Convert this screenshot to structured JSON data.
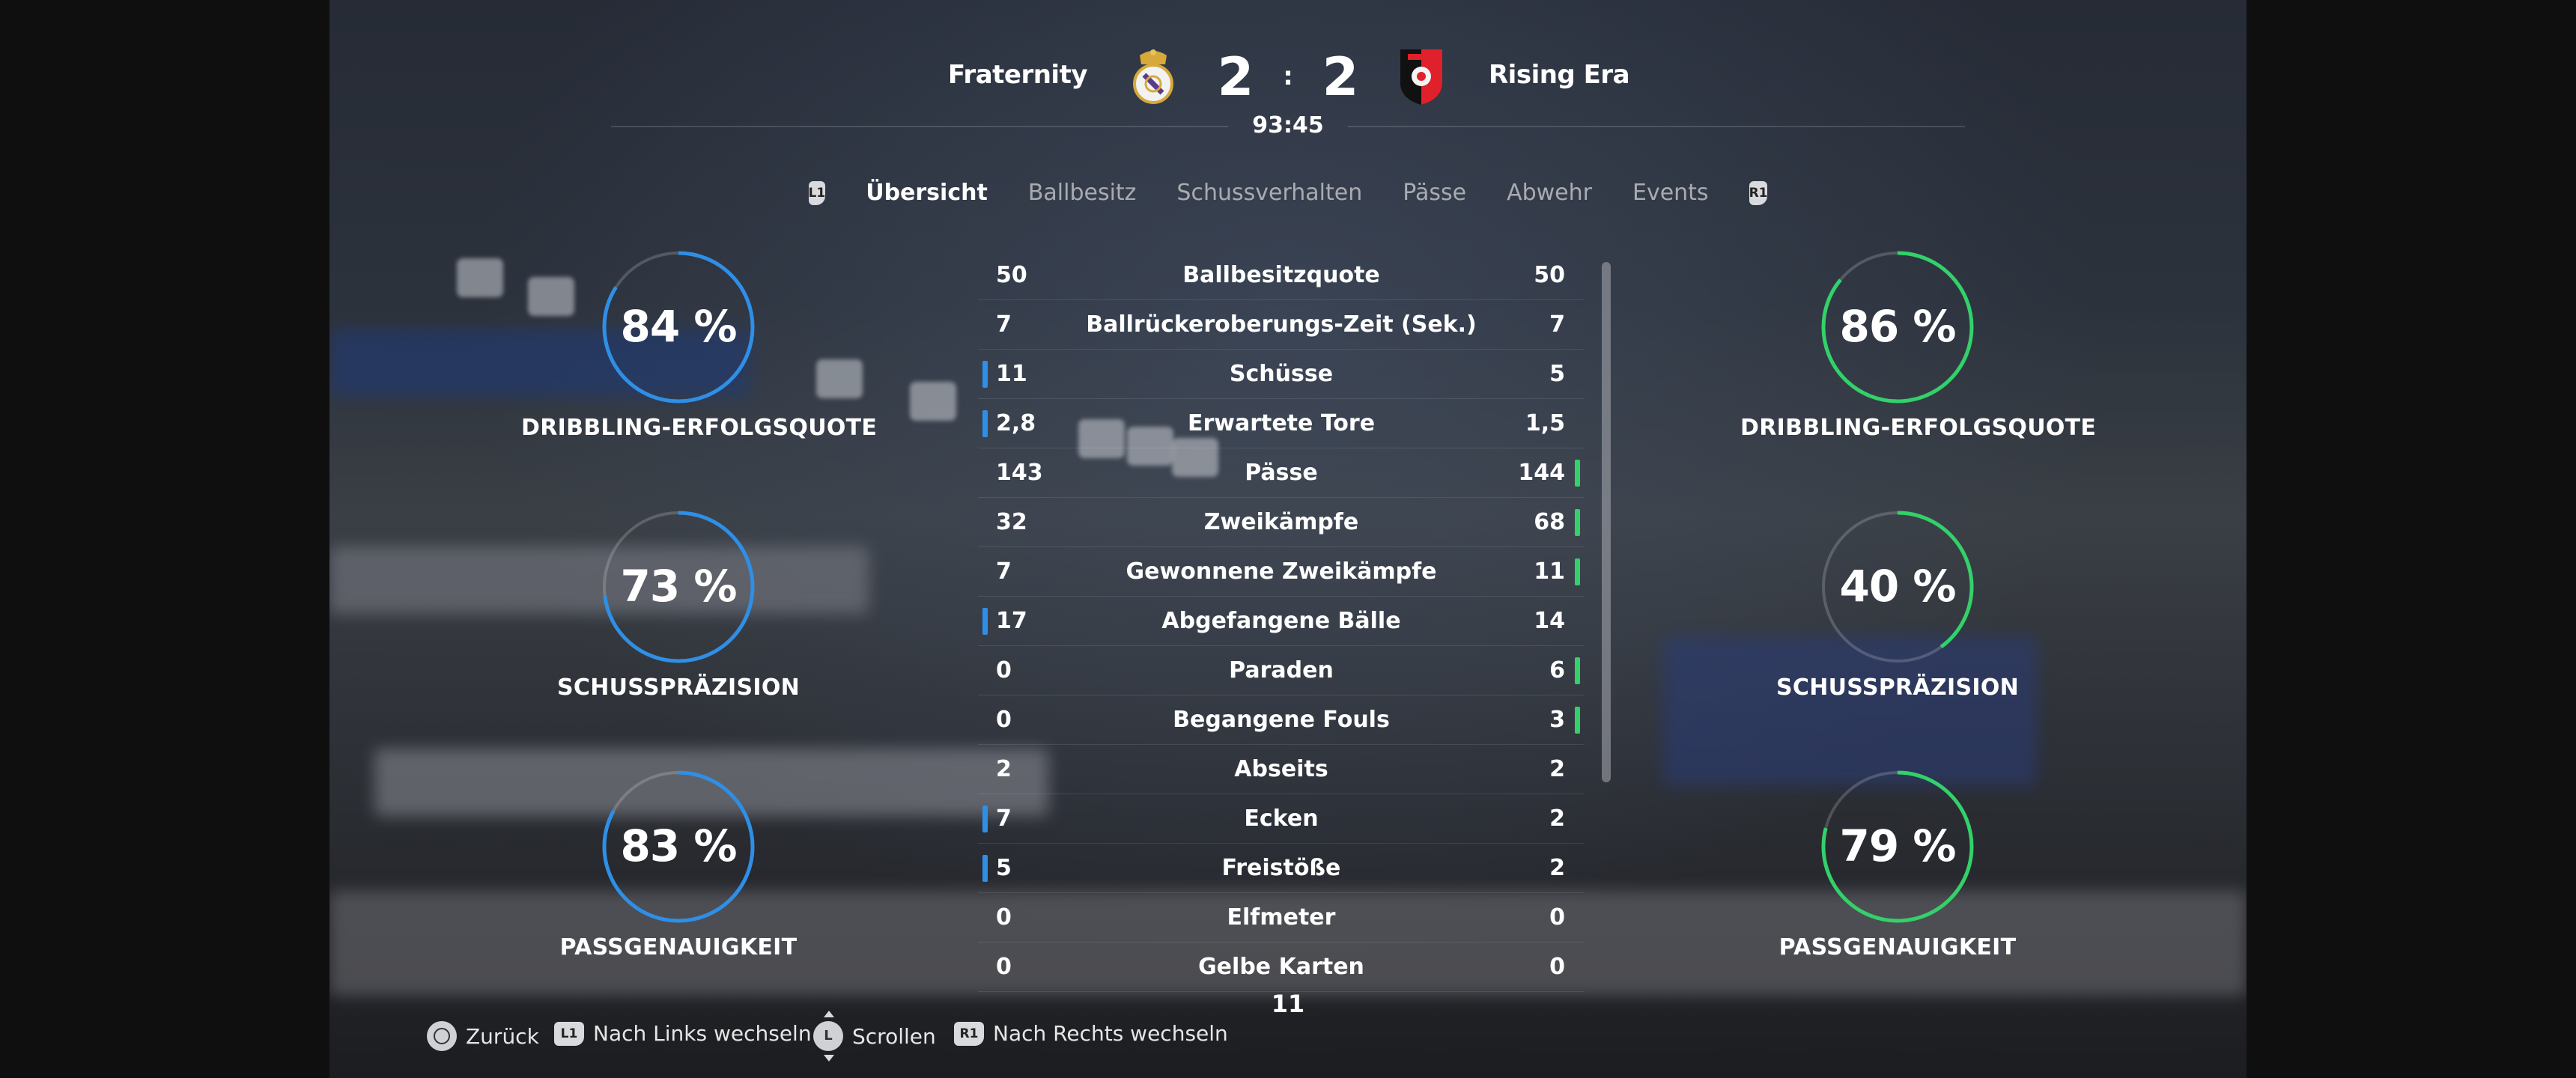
{
  "match": {
    "home": {
      "name": "Fraternity",
      "score": "2",
      "crest_icon": "real-madrid-crest-icon",
      "color": "#2f8fe6"
    },
    "away": {
      "name": "Rising Era",
      "score": "2",
      "crest_icon": "stade-rennais-crest-icon",
      "color": "#33d16a"
    },
    "separator": ":",
    "time": "93:45"
  },
  "tabs": {
    "left_button": "L1",
    "right_button": "R1",
    "items": [
      "Übersicht",
      "Ballbesitz",
      "Schussverhalten",
      "Pässe",
      "Abwehr",
      "Events"
    ],
    "active_index": 0
  },
  "gauges": {
    "home": [
      {
        "value": "84 %",
        "percent": 84,
        "label": "DRIBBLING-ERFOLGSQUOTE"
      },
      {
        "value": "73 %",
        "percent": 73,
        "label": "SCHUSSPRÄZISION"
      },
      {
        "value": "83 %",
        "percent": 83,
        "label": "PASSGENAUIGKEIT"
      }
    ],
    "away": [
      {
        "value": "86 %",
        "percent": 86,
        "label": "DRIBBLING-ERFOLGSQUOTE"
      },
      {
        "value": "40 %",
        "percent": 40,
        "label": "SCHUSSPRÄZISION"
      },
      {
        "value": "79 %",
        "percent": 79,
        "label": "PASSGENAUIGKEIT"
      }
    ]
  },
  "stats": [
    {
      "label": "Ballbesitzquote",
      "home": "50",
      "away": "50",
      "leader": ""
    },
    {
      "label": "Ballrückeroberungs-Zeit (Sek.)",
      "home": "7",
      "away": "7",
      "leader": ""
    },
    {
      "label": "Schüsse",
      "home": "11",
      "away": "5",
      "leader": "home"
    },
    {
      "label": "Erwartete Tore",
      "home": "2,8",
      "away": "1,5",
      "leader": "home"
    },
    {
      "label": "Pässe",
      "home": "143",
      "away": "144",
      "leader": "away"
    },
    {
      "label": "Zweikämpfe",
      "home": "32",
      "away": "68",
      "leader": "away"
    },
    {
      "label": "Gewonnene Zweikämpfe",
      "home": "7",
      "away": "11",
      "leader": "away"
    },
    {
      "label": "Abgefangene Bälle",
      "home": "17",
      "away": "14",
      "leader": "home"
    },
    {
      "label": "Paraden",
      "home": "0",
      "away": "6",
      "leader": "away"
    },
    {
      "label": "Begangene Fouls",
      "home": "0",
      "away": "3",
      "leader": "away"
    },
    {
      "label": "Abseits",
      "home": "2",
      "away": "2",
      "leader": ""
    },
    {
      "label": "Ecken",
      "home": "7",
      "away": "2",
      "leader": "home"
    },
    {
      "label": "Freistöße",
      "home": "5",
      "away": "2",
      "leader": "home"
    },
    {
      "label": "Elfmeter",
      "home": "0",
      "away": "0",
      "leader": ""
    },
    {
      "label": "Gelbe Karten",
      "home": "0",
      "away": "0",
      "leader": ""
    }
  ],
  "more_count": "11",
  "footer": {
    "back": {
      "label": "Zurück",
      "icon": "circle-button-icon"
    },
    "switch_left": {
      "label": "Nach Links wechseln",
      "button": "L1"
    },
    "scroll": {
      "label": "Scrollen",
      "button": "L"
    },
    "switch_right": {
      "label": "Nach Rechts wechseln",
      "button": "R1"
    }
  }
}
